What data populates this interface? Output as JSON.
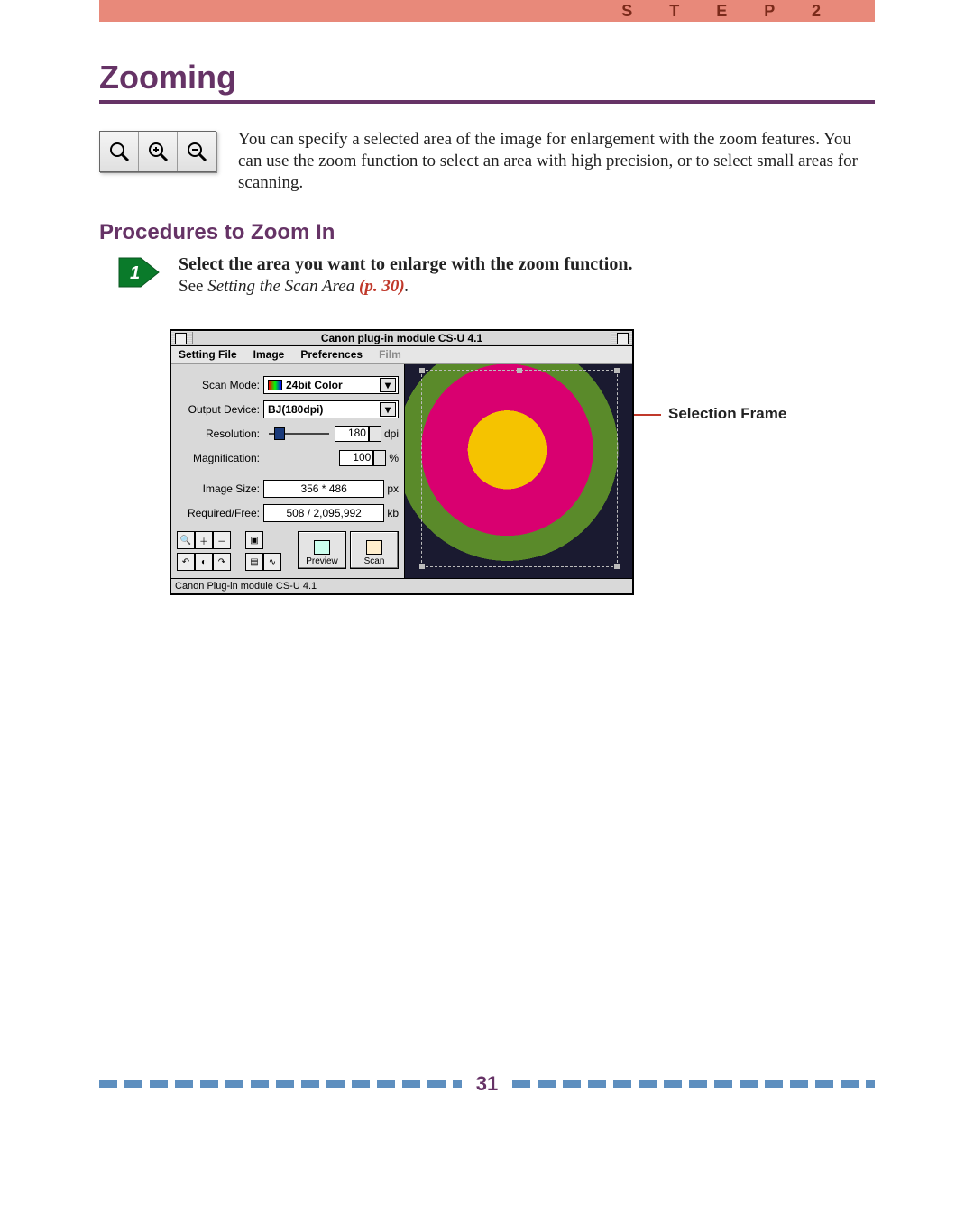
{
  "header": {
    "step_label": "S T E P   2"
  },
  "title": "Zooming",
  "intro": "You can specify a selected area of the image for enlargement with the zoom features. You can use the zoom function to select an area with high precision, or to select small areas for scanning.",
  "subtitle": "Procedures to Zoom In",
  "step1": {
    "number": "1",
    "headline": "Select the area you want to enlarge with the zoom function.",
    "see_prefix": "See ",
    "see_italic": "Setting the Scan Area ",
    "page_ref": "(p. 30)",
    "period": "."
  },
  "screenshot": {
    "window_title": "Canon plug-in module CS-U 4.1",
    "menus": {
      "m1": "Setting File",
      "m2": "Image",
      "m3": "Preferences",
      "m4": "Film"
    },
    "labels": {
      "scan_mode": "Scan Mode:",
      "output_device": "Output Device:",
      "resolution": "Resolution:",
      "magnification": "Magnification:",
      "image_size": "Image Size:",
      "required_free": "Required/Free:"
    },
    "values": {
      "scan_mode": "24bit Color",
      "output_device": "BJ(180dpi)",
      "resolution": "180",
      "resolution_unit": "dpi",
      "magnification": "100",
      "magnification_unit": "%",
      "image_size": "356 * 486",
      "image_size_unit": "px",
      "required_free": "508 / 2,095,992",
      "required_free_unit": "kb"
    },
    "buttons": {
      "preview": "Preview",
      "scan": "Scan"
    },
    "status": "Canon Plug-in module CS-U 4.1"
  },
  "callout": "Selection Frame",
  "page_number": "31"
}
